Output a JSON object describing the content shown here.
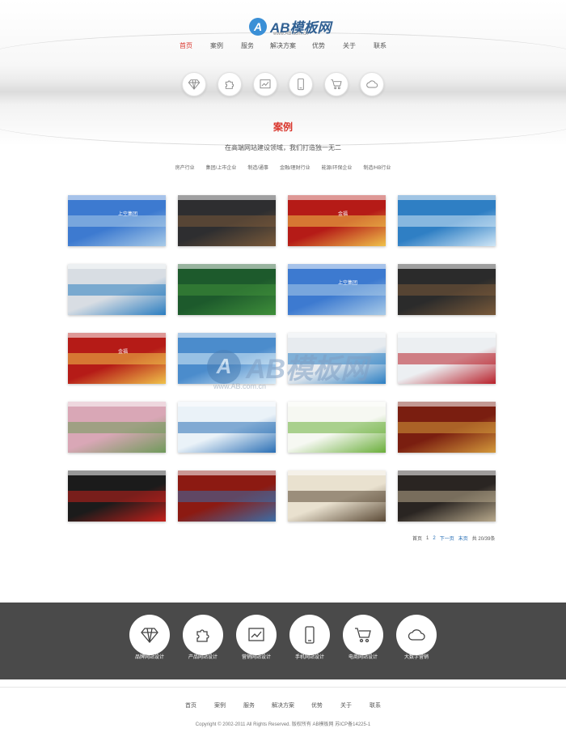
{
  "logo": {
    "mark": "A",
    "text": "AB模板网",
    "url": "www.AB.com.cn"
  },
  "nav": [
    "首页",
    "案例",
    "服务",
    "解决方案",
    "优势",
    "关于",
    "联系"
  ],
  "nav_active_index": 0,
  "service_icons": [
    "diamond-icon",
    "puzzle-icon",
    "chart-icon",
    "phone-icon",
    "cart-icon",
    "cloud-icon"
  ],
  "section": {
    "title": "案例",
    "subtitle": "在高端网站建设领域，我们打造独一无二",
    "filters": [
      "房产行业",
      "集团/上市企业",
      "制造/通事",
      "金融/理财行业",
      "能源/环保企业",
      "制造/HB行业"
    ]
  },
  "cases": [
    {
      "title": "上空集团",
      "color": "#3d7ad0",
      "accent": "#a9cbe8"
    },
    {
      "title": "",
      "color": "#2e2e30",
      "accent": "#7a5a3a"
    },
    {
      "title": "金福",
      "color": "#b51b17",
      "accent": "#f0c24a"
    },
    {
      "title": "",
      "color": "#2f7fc4",
      "accent": "#cfe6f6"
    },
    {
      "title": "",
      "color": "#d8dde3",
      "accent": "#2b7dc0"
    },
    {
      "title": "",
      "color": "#1d5a2c",
      "accent": "#3f8f3a"
    },
    {
      "title": "上空集团",
      "color": "#3d7ad0",
      "accent": "#a9cbe8"
    },
    {
      "title": "",
      "color": "#2b2b2b",
      "accent": "#7a5a3a"
    },
    {
      "title": "金福",
      "color": "#b51b17",
      "accent": "#f0c24a"
    },
    {
      "title": "",
      "color": "#4b8ccc",
      "accent": "#d9ecf8"
    },
    {
      "title": "",
      "color": "#e7ebef",
      "accent": "#2c7fc3"
    },
    {
      "title": "",
      "color": "#eceff2",
      "accent": "#b8202a"
    },
    {
      "title": "",
      "color": "#d9a7b6",
      "accent": "#6f9a5a"
    },
    {
      "title": "",
      "color": "#eaf2f8",
      "accent": "#2a6fb5"
    },
    {
      "title": "",
      "color": "#f6f8f2",
      "accent": "#6aae3a"
    },
    {
      "title": "",
      "color": "#7a1e10",
      "accent": "#d49a3b"
    },
    {
      "title": "",
      "color": "#1b1b1b",
      "accent": "#c4201b"
    },
    {
      "title": "",
      "color": "#8c1a12",
      "accent": "#3c6ea8"
    },
    {
      "title": "",
      "color": "#e9e1cf",
      "accent": "#5b4a36"
    },
    {
      "title": "",
      "color": "#2a2522",
      "accent": "#b8a98c"
    }
  ],
  "watermark": {
    "mark": "A",
    "text": "AB模板网",
    "url": "www.AB.com.cn"
  },
  "pagination": {
    "first": "首页",
    "pages": [
      "1",
      "2"
    ],
    "next": "下一页",
    "last": "末页",
    "total": "共 20/39条"
  },
  "services": [
    {
      "label": "品牌网站设计",
      "icon": "diamond-icon"
    },
    {
      "label": "产品网站设计",
      "icon": "puzzle-icon"
    },
    {
      "label": "营销网站设计",
      "icon": "chart-icon"
    },
    {
      "label": "手机网站设计",
      "icon": "phone-icon"
    },
    {
      "label": "电商网站设计",
      "icon": "cart-icon"
    },
    {
      "label": "大数字营销",
      "icon": "cloud-icon"
    }
  ],
  "footer_nav": [
    "首页",
    "案例",
    "服务",
    "解决方案",
    "优势",
    "关于",
    "联系"
  ],
  "copyright": "Copyright © 2002-2011 All Rights Reserved. 版权所有 AB模板网 苏ICP备14225-1",
  "colors": {
    "accent": "#d9342b",
    "dark_band": "#4a4a4a",
    "link": "#1f69b3"
  }
}
